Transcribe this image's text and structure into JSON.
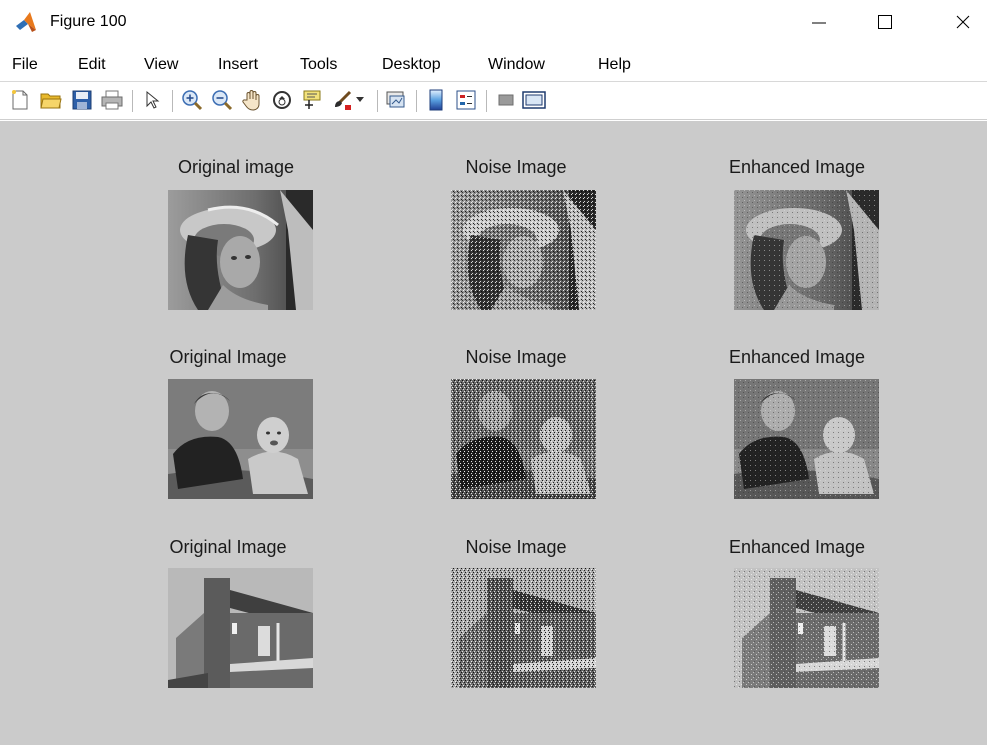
{
  "window": {
    "title": "Figure 100"
  },
  "menu": [
    "File",
    "Edit",
    "View",
    "Insert",
    "Tools",
    "Desktop",
    "Window",
    "Help"
  ],
  "toolbar_icons": [
    "new-figure-icon",
    "open-file-icon",
    "save-icon",
    "print-icon",
    "edit-plot-icon",
    "zoom-in-icon",
    "zoom-out-icon",
    "pan-icon",
    "rotate-3d-icon",
    "data-cursor-icon",
    "brush-icon",
    "dropdown-arrow-icon",
    "link-plot-icon",
    "insert-colorbar-icon",
    "insert-legend-icon",
    "hide-plot-tools-icon",
    "show-plot-tools-icon"
  ],
  "grid": {
    "rows": [
      {
        "titles": [
          "Original image",
          "Noise Image",
          "Enhanced Image"
        ]
      },
      {
        "titles": [
          "Original Image",
          "Noise Image",
          "Enhanced Image"
        ]
      },
      {
        "titles": [
          "Original Image",
          "Noise Image",
          "Enhanced Image"
        ]
      }
    ]
  },
  "colors": {
    "figure_bg": "#cbcbcb",
    "titlebar_bg": "#ffffff"
  }
}
